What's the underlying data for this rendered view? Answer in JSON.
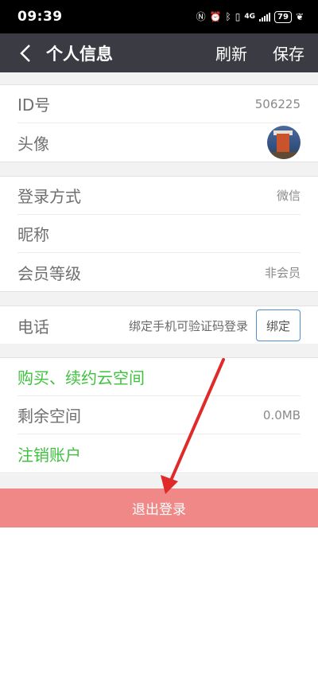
{
  "status": {
    "time": "09:39",
    "network": "4G",
    "battery": "79"
  },
  "nav": {
    "title": "个人信息",
    "refresh": "刷新",
    "save": "保存"
  },
  "profile": {
    "id_label": "ID号",
    "id_value": "506225",
    "avatar_label": "头像"
  },
  "account": {
    "login_label": "登录方式",
    "login_value": "微信",
    "nickname_label": "昵称",
    "level_label": "会员等级",
    "level_value": "非会员"
  },
  "phone": {
    "label": "电话",
    "hint": "绑定手机可验证码登录",
    "bind_button": "绑定"
  },
  "cloud": {
    "buy_label": "购买、续约云空间",
    "space_label": "剩余空间",
    "space_value": "0.0MB",
    "cancel_label": "注销账户"
  },
  "logout_label": "退出登录",
  "colors": {
    "navbar": "#3b3c43",
    "green": "#3ec23e",
    "logout": "#f08888",
    "arrow": "#e02a2a"
  }
}
